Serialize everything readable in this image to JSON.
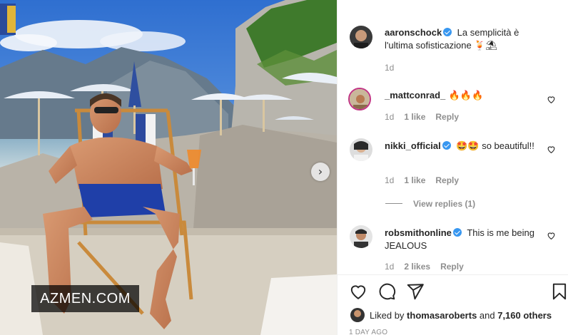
{
  "watermark": "AZMEN.COM",
  "post": {
    "author": "aaronschock",
    "caption": "La semplicità è l'ultima sofisticazione 🍹⛱",
    "time": "1d"
  },
  "comments": [
    {
      "user": "_mattconrad_",
      "verified": false,
      "text": "🔥🔥🔥",
      "time": "1d",
      "likes": "1 like",
      "reply": "Reply"
    },
    {
      "user": "nikki_official",
      "verified": true,
      "text": "🤩🤩 so beautiful!!",
      "time": "1d",
      "likes": "1 like",
      "reply": "Reply",
      "view_replies": "View replies (1)"
    },
    {
      "user": "robsmithonline",
      "verified": true,
      "text": "This is me being JEALOUS",
      "time": "1d",
      "likes": "2 likes",
      "reply": "Reply"
    }
  ],
  "likes": {
    "prefix": "Liked by ",
    "user": "thomasaroberts",
    "middle": " and ",
    "count": "7,160 others"
  },
  "posted_ago": "1 DAY AGO",
  "icons": [
    "like-icon",
    "comment-icon",
    "share-icon",
    "save-icon",
    "next-arrow-icon"
  ],
  "colors": {
    "verified": "#3897f0",
    "muted": "#8e8e8e",
    "text": "#262626"
  }
}
